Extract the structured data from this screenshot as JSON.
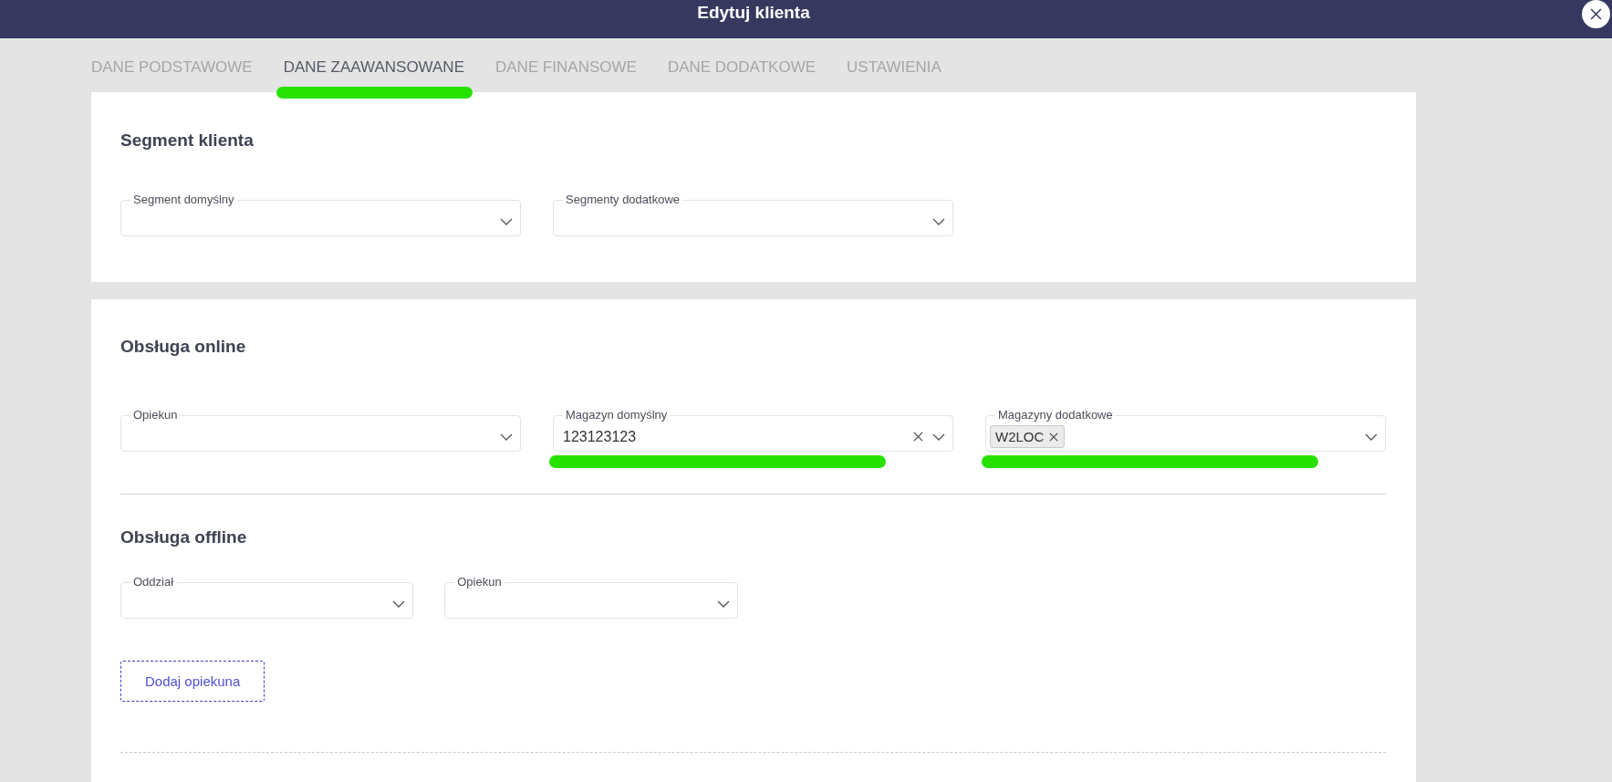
{
  "dialog": {
    "title": "Edytuj klienta"
  },
  "tabs": [
    {
      "label": "DANE PODSTAWOWE",
      "selected": false,
      "highlighted": false
    },
    {
      "label": "DANE ZAAWANSOWANE",
      "selected": true,
      "highlighted": true
    },
    {
      "label": "DANE FINANSOWE",
      "selected": false,
      "highlighted": false
    },
    {
      "label": "DANE DODATKOWE",
      "selected": false,
      "highlighted": false
    },
    {
      "label": "USTAWIENIA",
      "selected": false,
      "highlighted": false
    }
  ],
  "cards": [
    {
      "sections": [
        {
          "title": "Segment klienta",
          "fields": [
            {
              "label": "Segment domyślny",
              "highlighted": false
            },
            {
              "label": "Segmenty dodatkowe",
              "highlighted": false
            }
          ]
        }
      ]
    },
    {
      "sections": [
        {
          "title": "Obsługa online",
          "fields": [
            {
              "label": "Opiekun",
              "highlighted": false
            },
            {
              "label": "Magazyn domyślny",
              "value": "123123123",
              "highlighted": true
            },
            {
              "label": "Magazyny dodatkowe",
              "chips": [
                "W2LOC"
              ],
              "highlighted": true
            }
          ]
        },
        {
          "title": "Obsługa offline",
          "fields": [
            {
              "label": "Oddział",
              "highlighted": false
            },
            {
              "label": "Opiekun",
              "highlighted": false
            }
          ],
          "button": "Dodaj opiekuna"
        }
      ]
    }
  ]
}
